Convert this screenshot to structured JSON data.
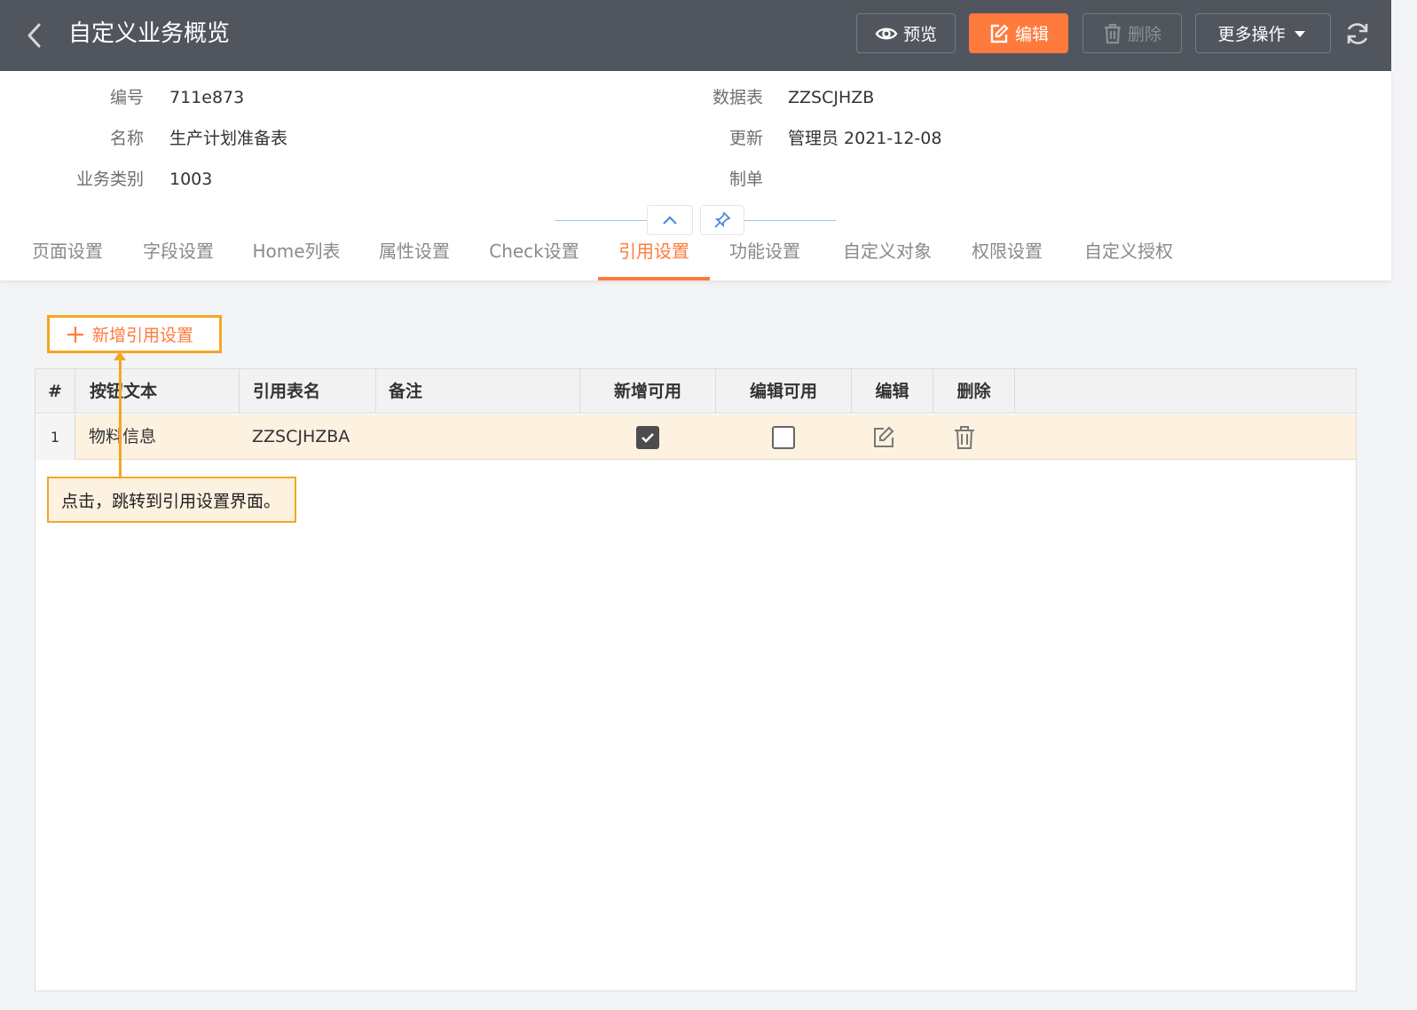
{
  "header": {
    "title": "自定义业务概览",
    "buttons": {
      "preview": "预览",
      "edit": "编辑",
      "delete": "删除",
      "more": "更多操作"
    }
  },
  "info": {
    "left": [
      {
        "label": "编号",
        "value": "711e873"
      },
      {
        "label": "名称",
        "value": "生产计划准备表"
      },
      {
        "label": "业务类别",
        "value": "1003"
      }
    ],
    "right": [
      {
        "label": "数据表",
        "value": "ZZSCJHZB"
      },
      {
        "label": "更新",
        "value": "管理员 2021-12-08"
      },
      {
        "label": "制单",
        "value": ""
      }
    ]
  },
  "tabs": [
    {
      "label": "页面设置",
      "active": false
    },
    {
      "label": "字段设置",
      "active": false
    },
    {
      "label": "Home列表",
      "active": false
    },
    {
      "label": "属性设置",
      "active": false
    },
    {
      "label": "Check设置",
      "active": false
    },
    {
      "label": "引用设置",
      "active": true
    },
    {
      "label": "功能设置",
      "active": false
    },
    {
      "label": "自定义对象",
      "active": false
    },
    {
      "label": "权限设置",
      "active": false
    },
    {
      "label": "自定义授权",
      "active": false
    }
  ],
  "toolbar": {
    "add_label": "新增引用设置"
  },
  "table": {
    "columns": [
      "#",
      "按钮文本",
      "引用表名",
      "备注",
      "新增可用",
      "编辑可用",
      "编辑",
      "删除"
    ],
    "rows": [
      {
        "index": "1",
        "button_text": "物料信息",
        "ref_table": "ZZSCJHZBA",
        "note": "",
        "add_enabled": true,
        "edit_enabled": false
      }
    ]
  },
  "annotation": {
    "text": "点击，跳转到引用设置界面。"
  },
  "colors": {
    "accent": "#ff7a3d",
    "header_bg": "#51565e",
    "highlight": "#f5a623",
    "row_selected": "#fdf1e0"
  }
}
